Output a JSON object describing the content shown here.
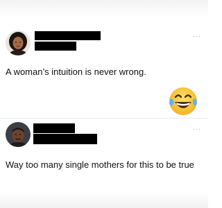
{
  "posts": [
    {
      "text": "A woman’s intuition is never wrong.",
      "more_label": "···",
      "author": "redacted"
    },
    {
      "text": "Way too many single mothers for this to be true",
      "more_label": "···",
      "author": "redacted"
    }
  ],
  "reaction": {
    "icon": "face-with-tears-of-joy-icon"
  },
  "colors": {
    "background": "#ffffff",
    "text": "#0f1419",
    "redaction": "#000000",
    "muted": "#9aa1a6"
  }
}
